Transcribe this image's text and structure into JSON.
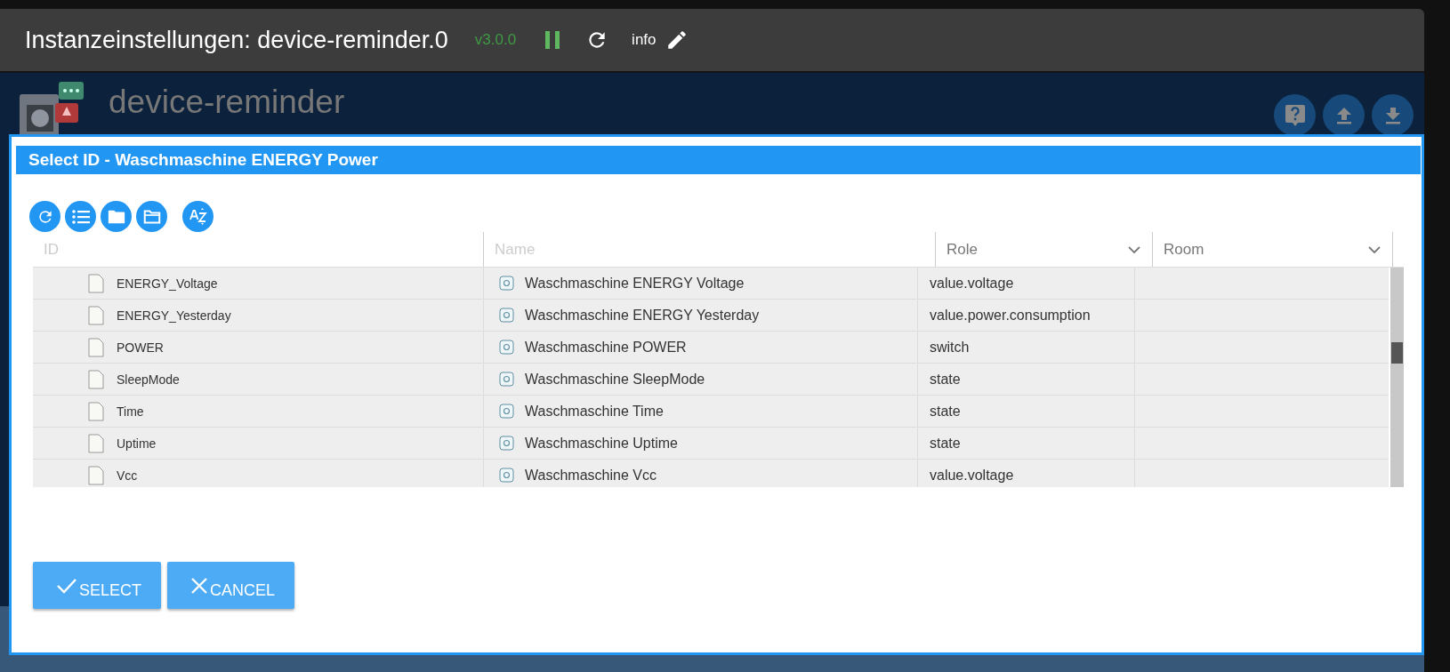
{
  "header": {
    "title": "Instanzeinstellungen: device-reminder.0",
    "version": "v3.0.0",
    "info": "info"
  },
  "adapter": {
    "name": "device-reminder"
  },
  "dialog": {
    "title": "Select ID - Waschmaschine ENERGY Power",
    "columns": [
      {
        "label": "ID",
        "kind": "text"
      },
      {
        "label": "Name",
        "kind": "text"
      },
      {
        "label": "Role",
        "kind": "select"
      },
      {
        "label": "Room",
        "kind": "select"
      }
    ],
    "rows": [
      {
        "id": "ENERGY_Voltage",
        "name": "Waschmaschine ENERGY Voltage",
        "role": "value.voltage"
      },
      {
        "id": "ENERGY_Yesterday",
        "name": "Waschmaschine ENERGY Yesterday",
        "role": "value.power.consumption"
      },
      {
        "id": "POWER",
        "name": "Waschmaschine POWER",
        "role": "switch"
      },
      {
        "id": "SleepMode",
        "name": "Waschmaschine SleepMode",
        "role": "state"
      },
      {
        "id": "Time",
        "name": "Waschmaschine Time",
        "role": "state"
      },
      {
        "id": "Uptime",
        "name": "Waschmaschine Uptime",
        "role": "state"
      },
      {
        "id": "Vcc",
        "name": "Waschmaschine Vcc",
        "role": "value.voltage"
      }
    ],
    "buttons": [
      {
        "label": "SELECT",
        "kind": "select"
      },
      {
        "label": "CANCEL",
        "kind": "cancel"
      }
    ]
  }
}
